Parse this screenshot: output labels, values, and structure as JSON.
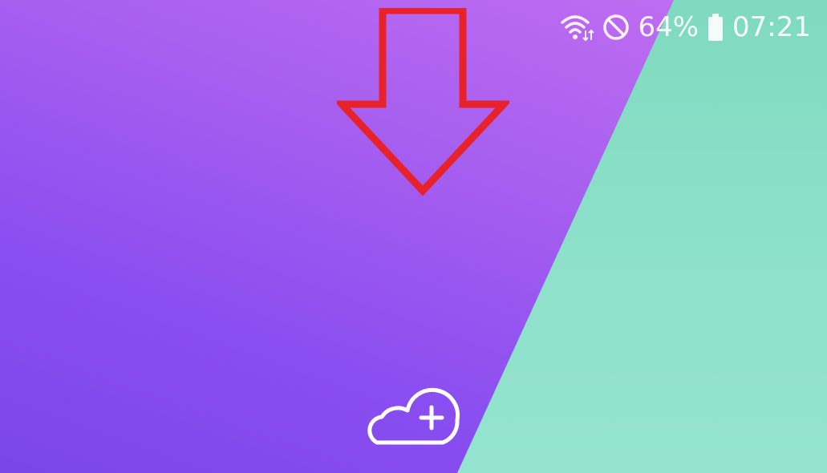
{
  "status_bar": {
    "battery_percent": "64%",
    "time": "07:21",
    "wifi_icon": "wifi-data-transfer-icon",
    "dnd_icon": "do-not-disturb-icon",
    "battery_icon": "battery-icon"
  },
  "annotation": {
    "icon": "arrow-down-icon",
    "color": "#e8222b"
  },
  "wallpaper": {
    "primary_color": "#a960ef",
    "secondary_color": "#8fe1cb"
  },
  "add_cloud": {
    "icon": "cloud-add-icon"
  }
}
